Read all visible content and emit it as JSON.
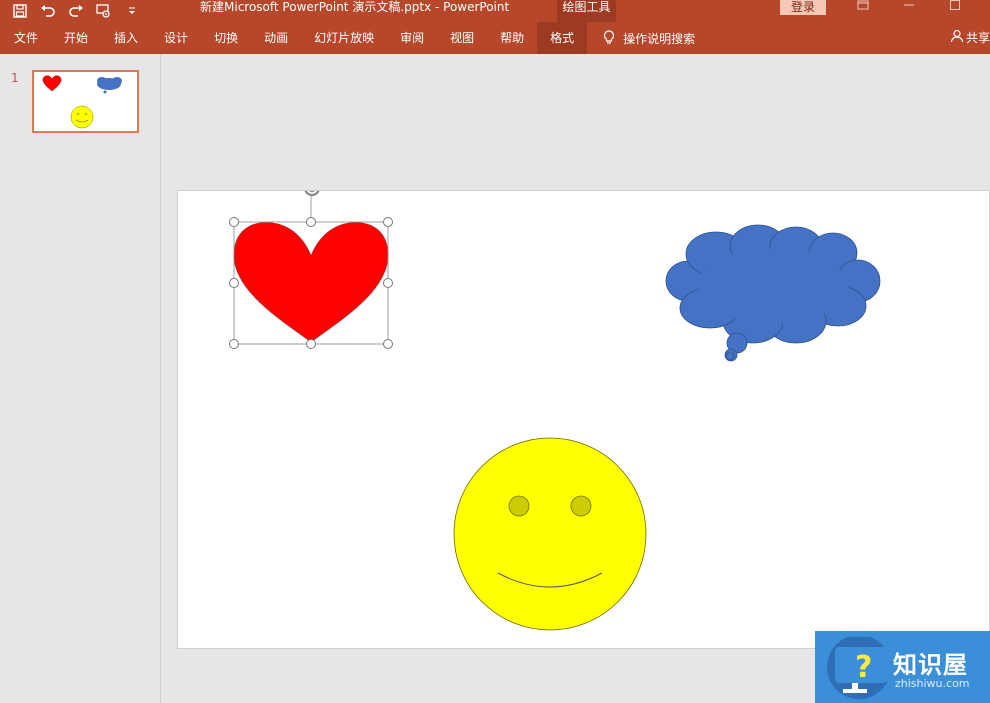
{
  "titlebar": {
    "doc_title": "新建Microsoft PowerPoint 演示文稿.pptx  -  PowerPoint",
    "tool_context": "绘图工具",
    "login": "登录",
    "colors": {
      "bar": "#b7472a",
      "context": "#9c3b22"
    }
  },
  "qat": {
    "icons": [
      "save-icon",
      "undo-icon",
      "redo-icon",
      "slideshow-from-start-icon",
      "customize-qat-icon"
    ],
    "glyphs": {
      "save": "💾",
      "undo": "↶",
      "redo": "↷",
      "present": "◫",
      "more": "▾"
    }
  },
  "ribbon": {
    "tabs": [
      {
        "label": "文件"
      },
      {
        "label": "开始"
      },
      {
        "label": "插入"
      },
      {
        "label": "设计"
      },
      {
        "label": "切换"
      },
      {
        "label": "动画"
      },
      {
        "label": "幻灯片放映"
      },
      {
        "label": "审阅"
      },
      {
        "label": "视图"
      },
      {
        "label": "帮助"
      },
      {
        "label": "格式"
      }
    ],
    "active_tab": "格式",
    "tell_me": "操作说明搜索",
    "share": "共享"
  },
  "thumbnails": [
    {
      "number": "1"
    }
  ],
  "slide": {
    "shapes": [
      {
        "type": "heart",
        "color": "#ff0000",
        "selected": true
      },
      {
        "type": "thought-bubble-cloud",
        "color": "#4472c4"
      },
      {
        "type": "smiley-face",
        "color": "#ffff00"
      }
    ]
  },
  "watermark": {
    "text": "知识屋",
    "sub": "zhishiwu.com",
    "icon": "question-icon"
  }
}
